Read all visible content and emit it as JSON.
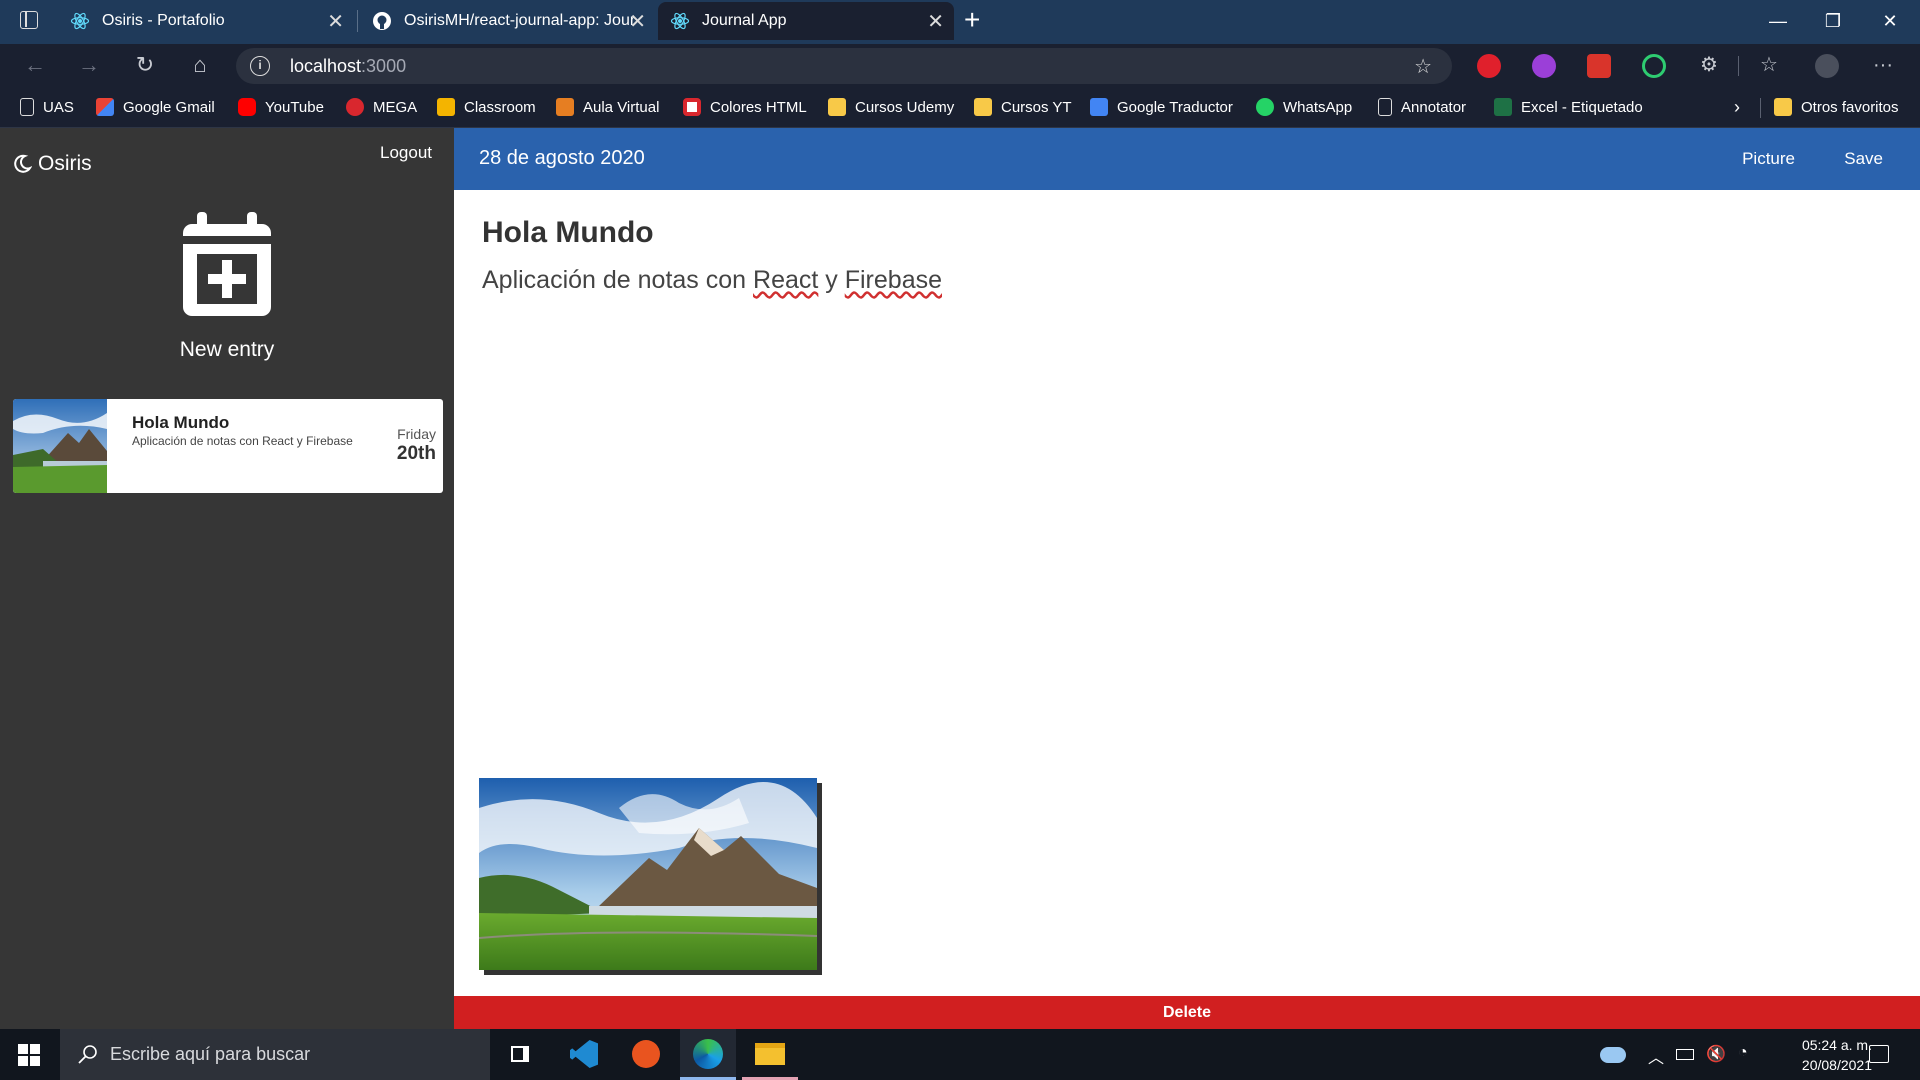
{
  "browser": {
    "tabs": [
      {
        "title": "Osiris - Portafolio",
        "icon": "react-icon"
      },
      {
        "title": "OsirisMH/react-journal-app: Jour",
        "icon": "github-icon"
      },
      {
        "title": "Journal App",
        "icon": "react-icon"
      }
    ],
    "active_tab": 2,
    "url_host": "localhost",
    "url_port": ":3000",
    "bookmarks": [
      {
        "label": "UAS",
        "icon": "page-icon"
      },
      {
        "label": "Google Gmail",
        "icon": "gmail-icon"
      },
      {
        "label": "YouTube",
        "icon": "youtube-icon"
      },
      {
        "label": "MEGA",
        "icon": "mega-icon"
      },
      {
        "label": "Classroom",
        "icon": "classroom-icon"
      },
      {
        "label": "Aula Virtual",
        "icon": "aula-icon"
      },
      {
        "label": "Colores HTML",
        "icon": "colores-icon"
      },
      {
        "label": "Cursos Udemy",
        "icon": "folder-icon"
      },
      {
        "label": "Cursos YT",
        "icon": "folder-icon"
      },
      {
        "label": "Google Traductor",
        "icon": "translate-icon"
      },
      {
        "label": "WhatsApp",
        "icon": "whatsapp-icon"
      },
      {
        "label": "Annotator",
        "icon": "page-icon"
      },
      {
        "label": "Excel - Etiquetado",
        "icon": "excel-icon"
      }
    ],
    "other_favorites": "Otros favoritos"
  },
  "sidebar": {
    "brand": "Osiris",
    "logout": "Logout",
    "new_entry": "New entry",
    "entries": [
      {
        "title": "Hola Mundo",
        "body": "Aplicación de notas con React y Firebase",
        "day": "Friday",
        "date": "20th"
      }
    ]
  },
  "note": {
    "date": "28 de agosto 2020",
    "picture_btn": "Picture",
    "save_btn": "Save",
    "title": "Hola Mundo",
    "body_prefix": "Aplicación de notas con ",
    "body_word1": "React",
    "body_mid": " y ",
    "body_word2": "Firebase",
    "delete_btn": "Delete"
  },
  "taskbar": {
    "search_placeholder": "Escribe aquí para buscar",
    "time": "05:24 a. m.",
    "date": "20/08/2021"
  },
  "colors": {
    "sidebar_bg": "#363636",
    "note_bar": "#2a62ad",
    "delete": "#d11f20"
  }
}
